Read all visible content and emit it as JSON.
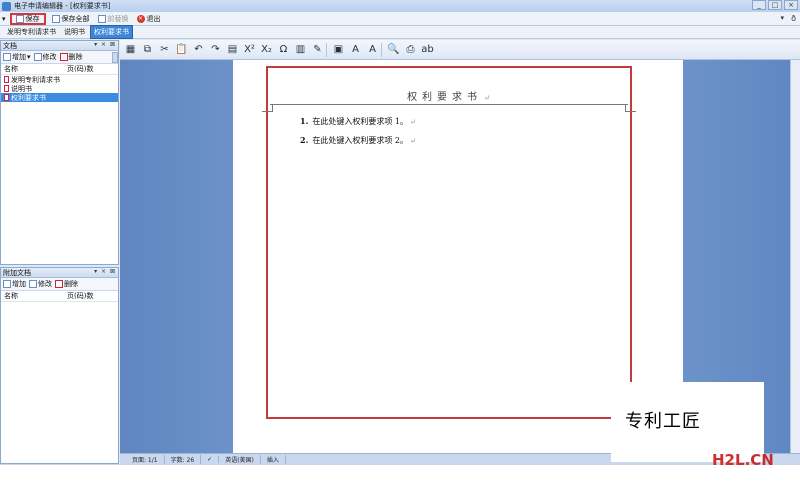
{
  "window": {
    "title": "电子申请编辑器 - [权利要求书]",
    "min": "_",
    "max": "□",
    "close": "×"
  },
  "toolbar": {
    "save": "保存",
    "save_all": "保存全部",
    "preview": "前替换",
    "exit": "退出",
    "right_glyph": "ð",
    "pin": "▾"
  },
  "tabs": [
    {
      "label": "发明专利请求书"
    },
    {
      "label": "说明书"
    },
    {
      "label": "权利要求书"
    }
  ],
  "docs_panel": {
    "title": "文档",
    "ctrls": "▾ × ⊠",
    "add": "增加",
    "edit": "修改",
    "delete": "删除",
    "col_name": "名称",
    "col_pages": "页(码)数",
    "items": [
      {
        "label": "发明专利请求书"
      },
      {
        "label": "说明书"
      },
      {
        "label": "权利要求书"
      }
    ]
  },
  "attach_panel": {
    "title": "附加文档",
    "ctrls": "▾ × ⊠",
    "add": "增加",
    "edit": "修改",
    "delete": "删除",
    "col_name": "名称",
    "col_pages": "页(码)数"
  },
  "document": {
    "title": "权利要求书",
    "title_mark": "↵",
    "claims": [
      {
        "num": "1.",
        "text": "在此处键入权利要求项 1。",
        "mark": "↵"
      },
      {
        "num": "2.",
        "text": "在此处键入权利要求项 2。",
        "mark": "↵"
      }
    ]
  },
  "statusbar": {
    "page": "页面: 1/1",
    "words": "字数: 26",
    "lang": "英语(美国)",
    "mode": "插入"
  },
  "watermark": {
    "text": "专利工匠",
    "logo_h2l": "H2L",
    "logo_dot": ".",
    "logo_cn": "CN"
  },
  "edit_tools": [
    {
      "name": "new-doc-icon",
      "glyph": "▦"
    },
    {
      "name": "copy-icon",
      "glyph": "⧉"
    },
    {
      "name": "cut-icon",
      "glyph": "✂"
    },
    {
      "name": "paste-icon",
      "glyph": "📋"
    },
    {
      "name": "undo-icon",
      "glyph": "↶"
    },
    {
      "name": "redo-icon",
      "glyph": "↷"
    },
    {
      "name": "table-icon",
      "glyph": "▤"
    },
    {
      "name": "superscript-icon",
      "glyph": "X²"
    },
    {
      "name": "subscript-icon",
      "glyph": "X₂"
    },
    {
      "name": "symbol-icon",
      "glyph": "Ω"
    },
    {
      "name": "insert-image-icon",
      "glyph": "▥"
    },
    {
      "name": "format-icon",
      "glyph": "✎"
    },
    {
      "name": "sep",
      "glyph": ""
    },
    {
      "name": "page-setup-icon",
      "glyph": "▣"
    },
    {
      "name": "font-increase-icon",
      "glyph": "A"
    },
    {
      "name": "font-decrease-icon",
      "glyph": "A"
    },
    {
      "name": "sep",
      "glyph": ""
    },
    {
      "name": "find-icon",
      "glyph": "🔍"
    },
    {
      "name": "print-icon",
      "glyph": "⎙"
    },
    {
      "name": "spellcheck-icon",
      "glyph": "ab"
    }
  ]
}
